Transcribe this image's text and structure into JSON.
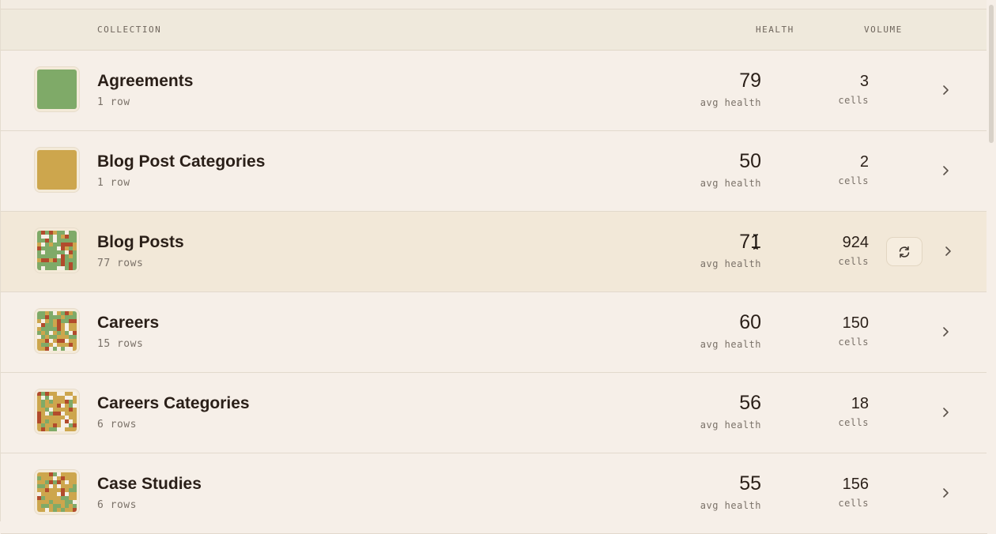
{
  "header": {
    "collection": "COLLECTION",
    "health": "HEALTH",
    "volume": "VOLUME"
  },
  "colors": {
    "green": "#7faa68",
    "gold": "#cda64d",
    "red": "#b24b2c",
    "white": "#f6f0e6"
  },
  "rows": [
    {
      "name": "Agreements",
      "rows_label": "1 row",
      "health": "79",
      "health_label": "avg health",
      "volume": "3",
      "volume_label": "cells",
      "thumb": "solid-green"
    },
    {
      "name": "Blog Post Categories",
      "rows_label": "1 row",
      "health": "50",
      "health_label": "avg health",
      "volume": "2",
      "volume_label": "cells",
      "thumb": "solid-gold"
    },
    {
      "name": "Blog Posts",
      "rows_label": "77 rows",
      "health": "71",
      "health_label": "avg health",
      "volume": "924",
      "volume_label": "cells",
      "thumb": "mosaic-green"
    },
    {
      "name": "Careers",
      "rows_label": "15 rows",
      "health": "60",
      "health_label": "avg health",
      "volume": "150",
      "volume_label": "cells",
      "thumb": "mosaic-mixed"
    },
    {
      "name": "Careers Categories",
      "rows_label": "6 rows",
      "health": "56",
      "health_label": "avg health",
      "volume": "18",
      "volume_label": "cells",
      "thumb": "mosaic-gold"
    },
    {
      "name": "Case Studies",
      "rows_label": "6 rows",
      "health": "55",
      "health_label": "avg health",
      "volume": "156",
      "volume_label": "cells",
      "thumb": "mosaic-gold"
    }
  ],
  "icons": {
    "chevron": "chevron-right-icon",
    "refresh": "refresh-icon",
    "cursor": "text-cursor-icon"
  }
}
